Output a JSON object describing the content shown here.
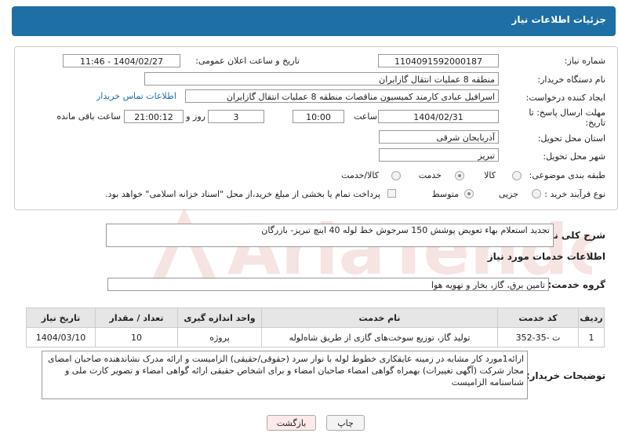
{
  "header": {
    "title": "جزئیات اطلاعات نیاز"
  },
  "form": {
    "need_number_label": "شماره نیاز:",
    "need_number": "1104091592000187",
    "announce_label": "تاریخ و ساعت اعلان عمومی:",
    "announce_value": "1404/02/27 - 11:46",
    "buyer_org_label": "نام دستگاه خریدار:",
    "buyer_org": "منطقه 8 عملیات انتقال گازایران",
    "creator_label": "ایجاد کننده درخواست:",
    "creator": "اسرافیل عبادی کارمند کمیسیون مناقصات منطقه 8 عملیات انتقال گازایران",
    "contact_link": "اطلاعات تماس خریدار",
    "deadline_label": "مهلت ارسال پاسخ: تا تاریخ:",
    "deadline_date": "1404/02/31",
    "hour_label": "ساعت",
    "deadline_time": "10:00",
    "days": "3",
    "days_label": "روز و",
    "remaining_time": "21:00:12",
    "remaining_label": "ساعت باقی مانده",
    "province_label": "استان محل تحویل:",
    "province": "آذربایجان شرقی",
    "city_label": "شهر محل تحویل:",
    "city": "تبریز",
    "category_label": "طبقه بندی موضوعی:",
    "category_options": [
      "کالا",
      "خدمت",
      "کالا/خدمت"
    ],
    "category_selected": "خدمت",
    "process_label": "نوع فرآیند خرید :",
    "process_options": [
      "جزیی",
      "متوسط"
    ],
    "process_selected": "متوسط",
    "payment_note": "پرداخت تمام یا بخشی از مبلغ خرید،از محل \"اسناد خزانه اسلامی\" خواهد بود."
  },
  "summary": {
    "label": "شرح کلی نیاز:",
    "text": "تجدید استعلام بهاء تعویض پوشش 150 سرجوش خط لوله 40 اینچ تبریز- بازرگان"
  },
  "services": {
    "section_title": "اطلاعات خدمات مورد نیاز",
    "group_label": "گروه خدمت:",
    "group_value": "تامین برق، گاز، بخار و تهویه هوا",
    "columns": [
      "ردیف",
      "کد خدمت",
      "نام خدمت",
      "واحد اندازه گیری",
      "تعداد / مقدار",
      "تاریخ نیاز"
    ],
    "rows": [
      [
        "1",
        "ت -35-352",
        "تولید گاز، توزیع سوخت‌های گازی از طریق شاه‌لوله",
        "پروژه",
        "10",
        "1404/03/10"
      ]
    ]
  },
  "buyer_notes": {
    "label": "توضیحات خریدار:",
    "text": "ارائه1مورد کار مشابه در زمینه عایقکاری خطوط لوله با نوار سرد (حقوقی/حقیقی) الزامیست و ارائه مدرک نشاندهنده صاحبان امضای مجاز شرکت (آگهی تغییرات) بهمراه گواهی امضاء صاحبان امضاء و برای اشخاص حقیقی ارائه گواهی امضاء و تصویر کارت ملی و شناسنامه الزامیست"
  },
  "buttons": {
    "print": "چاپ",
    "back": "بازگشت"
  },
  "watermark": {
    "text": "AriaTender.neT"
  },
  "colors": {
    "header_bg": "#1d6fa5",
    "link": "#1d6fa5",
    "back_btn_bg": "#fde9e9",
    "watermark": "#c0392b"
  }
}
